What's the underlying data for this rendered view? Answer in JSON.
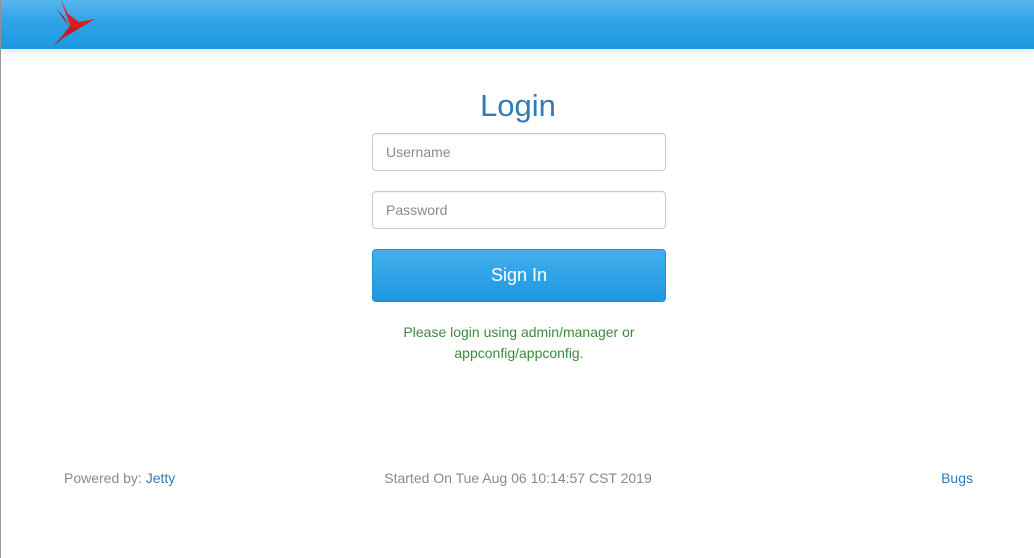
{
  "header": {
    "logo_icon": "red-bird-logo-icon",
    "background_color": "#1d98e2"
  },
  "login": {
    "title": "Login",
    "username_placeholder": "Username",
    "username_value": "",
    "password_placeholder": "Password",
    "password_value": "",
    "signin_label": "Sign In",
    "hint_line1": "Please login using admin/manager or",
    "hint_line2": "appconfig/appconfig.",
    "title_color": "#337ab7",
    "hint_color": "#3c8a3c"
  },
  "footer": {
    "powered_by_label": "Powered by:",
    "powered_by_link": "Jetty",
    "started_on": "Started On Tue Aug 06 10:14:57 CST 2019",
    "bugs_link": "Bugs"
  }
}
